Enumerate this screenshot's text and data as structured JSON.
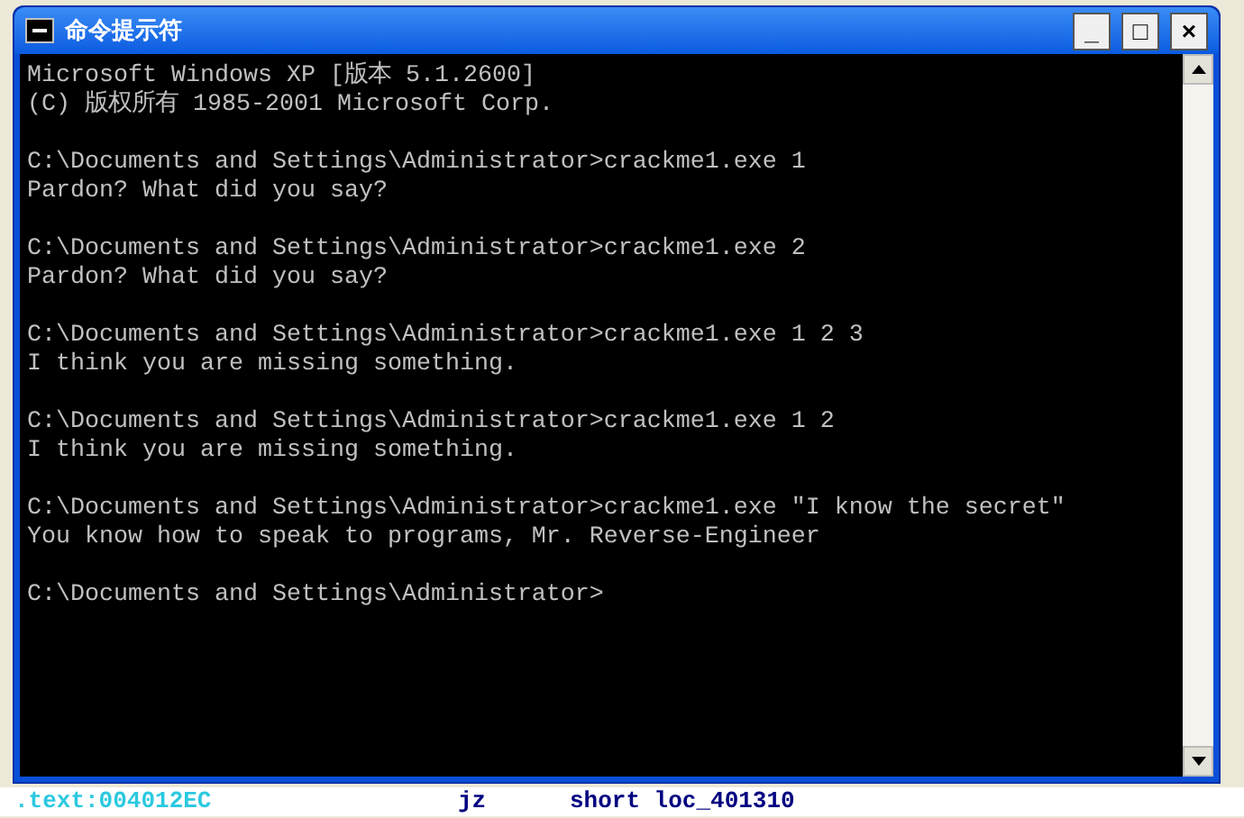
{
  "window": {
    "title": "命令提示符",
    "controls": [
      "_",
      "□",
      "×"
    ]
  },
  "console": {
    "blocks": [
      [
        "Microsoft Windows XP [版本 5.1.2600]",
        "(C) 版权所有 1985-2001 Microsoft Corp."
      ],
      [
        "C:\\Documents and Settings\\Administrator>crackme1.exe 1",
        "Pardon? What did you say?"
      ],
      [
        "C:\\Documents and Settings\\Administrator>crackme1.exe 2",
        "Pardon? What did you say?"
      ],
      [
        "C:\\Documents and Settings\\Administrator>crackme1.exe 1 2 3",
        "I think you are missing something."
      ],
      [
        "C:\\Documents and Settings\\Administrator>crackme1.exe 1 2",
        "I think you are missing something."
      ],
      [
        "C:\\Documents and Settings\\Administrator>crackme1.exe \"I know the secret\"",
        "You know how to speak to programs, Mr. Reverse-Engineer"
      ],
      [
        "C:\\Documents and Settings\\Administrator>"
      ]
    ]
  },
  "background_listing": {
    "address": ".text:004012EC",
    "mnemonic": "jz",
    "operand": "short loc_401310"
  }
}
